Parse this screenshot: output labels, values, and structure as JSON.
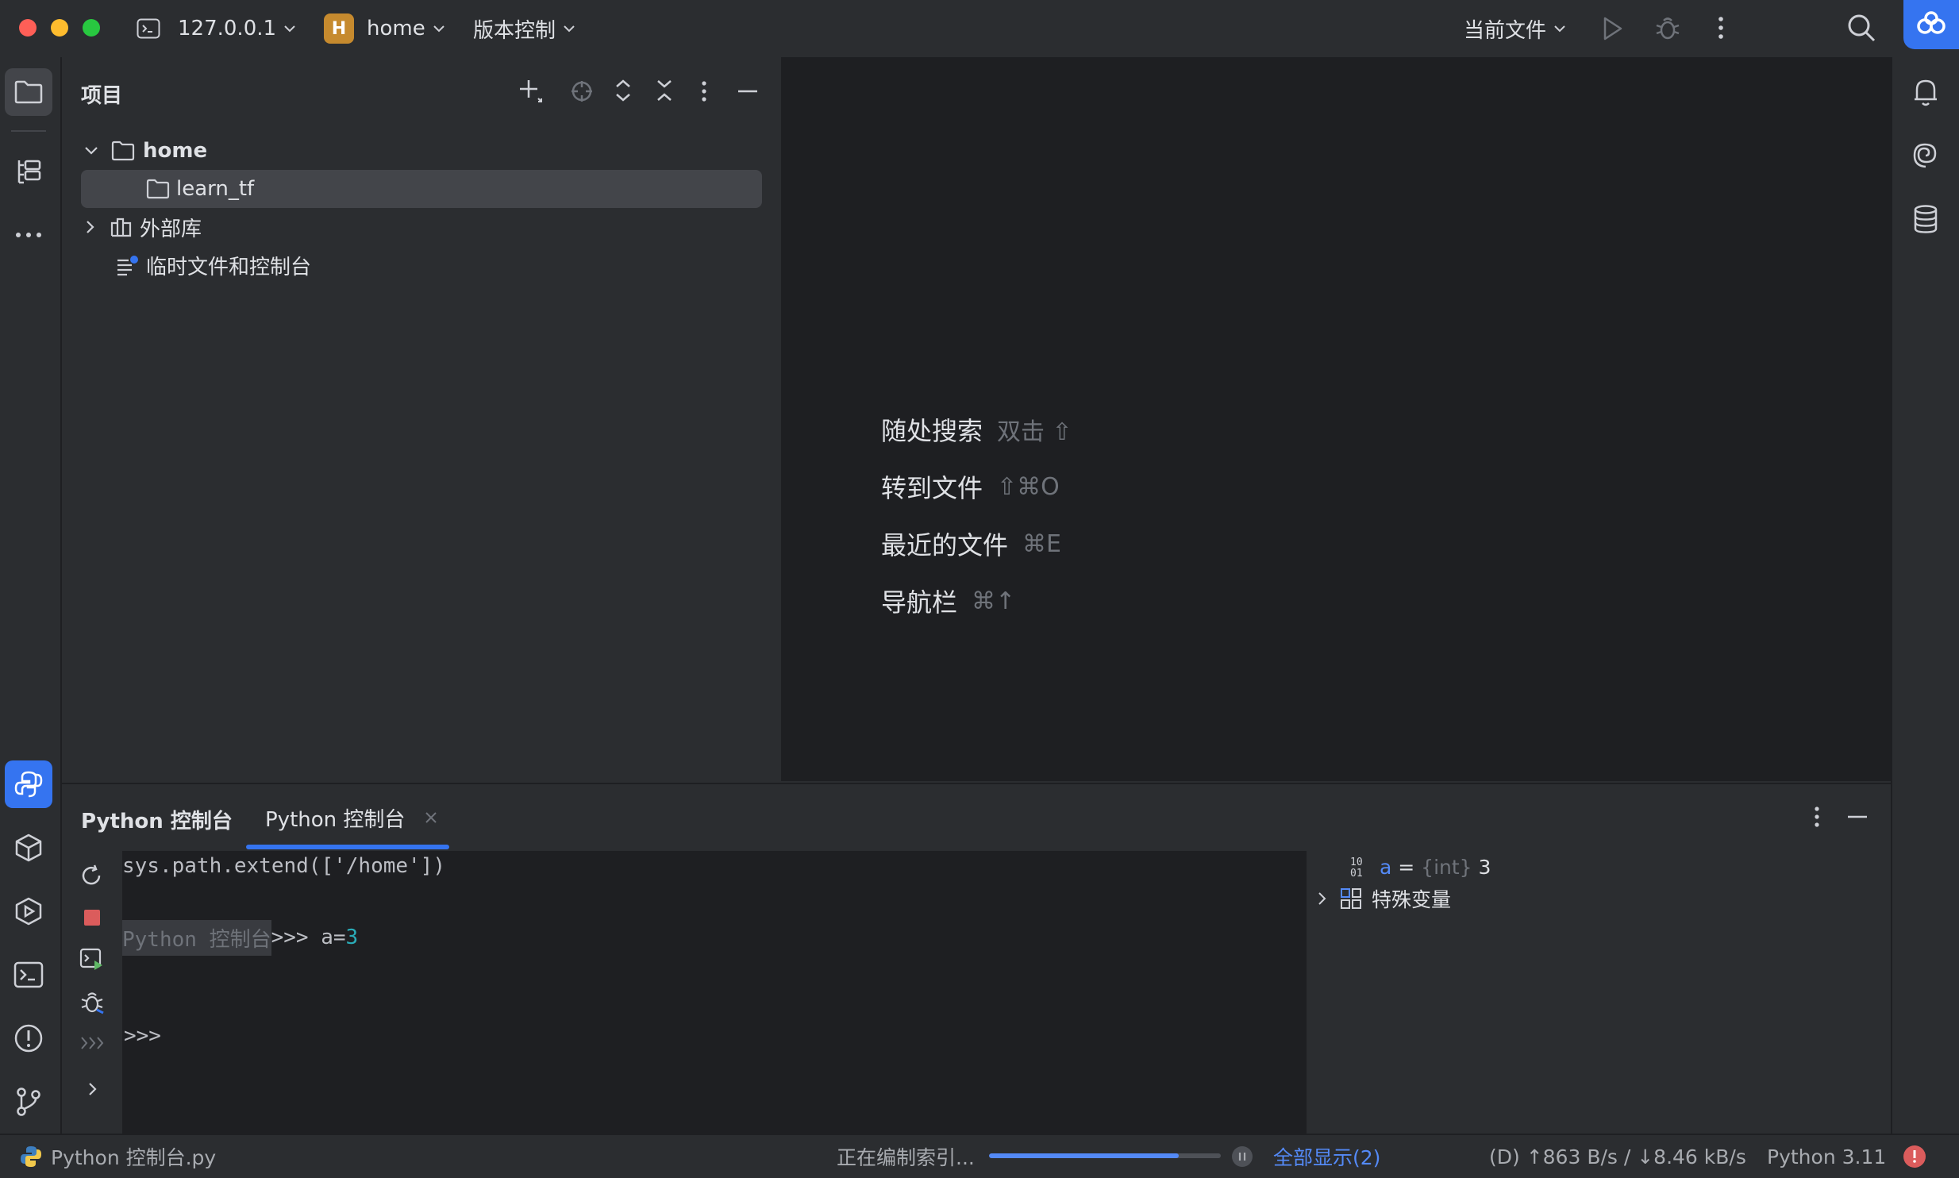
{
  "titlebar": {
    "host": "127.0.0.1",
    "project_badge": "H",
    "project": "home",
    "vcs": "版本控制",
    "run_config": "当前文件"
  },
  "project_panel": {
    "title": "项目",
    "tree": {
      "root": "home",
      "child_folder": "learn_tf",
      "external": "外部库",
      "scratches": "临时文件和控制台"
    }
  },
  "editor": {
    "hints": [
      {
        "label": "随处搜索",
        "shortcut": "双击 ⇧"
      },
      {
        "label": "转到文件",
        "shortcut": "⇧⌘O"
      },
      {
        "label": "最近的文件",
        "shortcut": "⌘E"
      },
      {
        "label": "导航栏",
        "shortcut": "⌘↑"
      }
    ]
  },
  "bottom_panel": {
    "title": "Python 控制台",
    "tab_label": "Python 控制台",
    "console": {
      "line1": "sys.path.extend(['/home'])",
      "prompt_label": "Python 控制台",
      "prompt_arrows": ">>>",
      "prompt_code": " a=",
      "prompt_value": "3",
      "empty_prompt": ">>>"
    },
    "variables": {
      "var_name": "a",
      "var_eq": " = ",
      "var_type": "{int}",
      "var_value": " 3",
      "special": "特殊变量"
    }
  },
  "statusbar": {
    "file": "Python 控制台.py",
    "indexing": "正在编制索引...",
    "indexing_progress": 0.82,
    "show_all": "全部显示(2)",
    "network": "(D) ↑863 B/s / ↓8.46 kB/s",
    "interpreter": "Python 3.11"
  },
  "colors": {
    "accent": "#3574f0",
    "selection": "#43454a",
    "editor_bg": "#1e1f22",
    "panel_bg": "#2b2d30",
    "error": "#db5c5c",
    "number": "#2aacb8",
    "link": "#548af7"
  }
}
